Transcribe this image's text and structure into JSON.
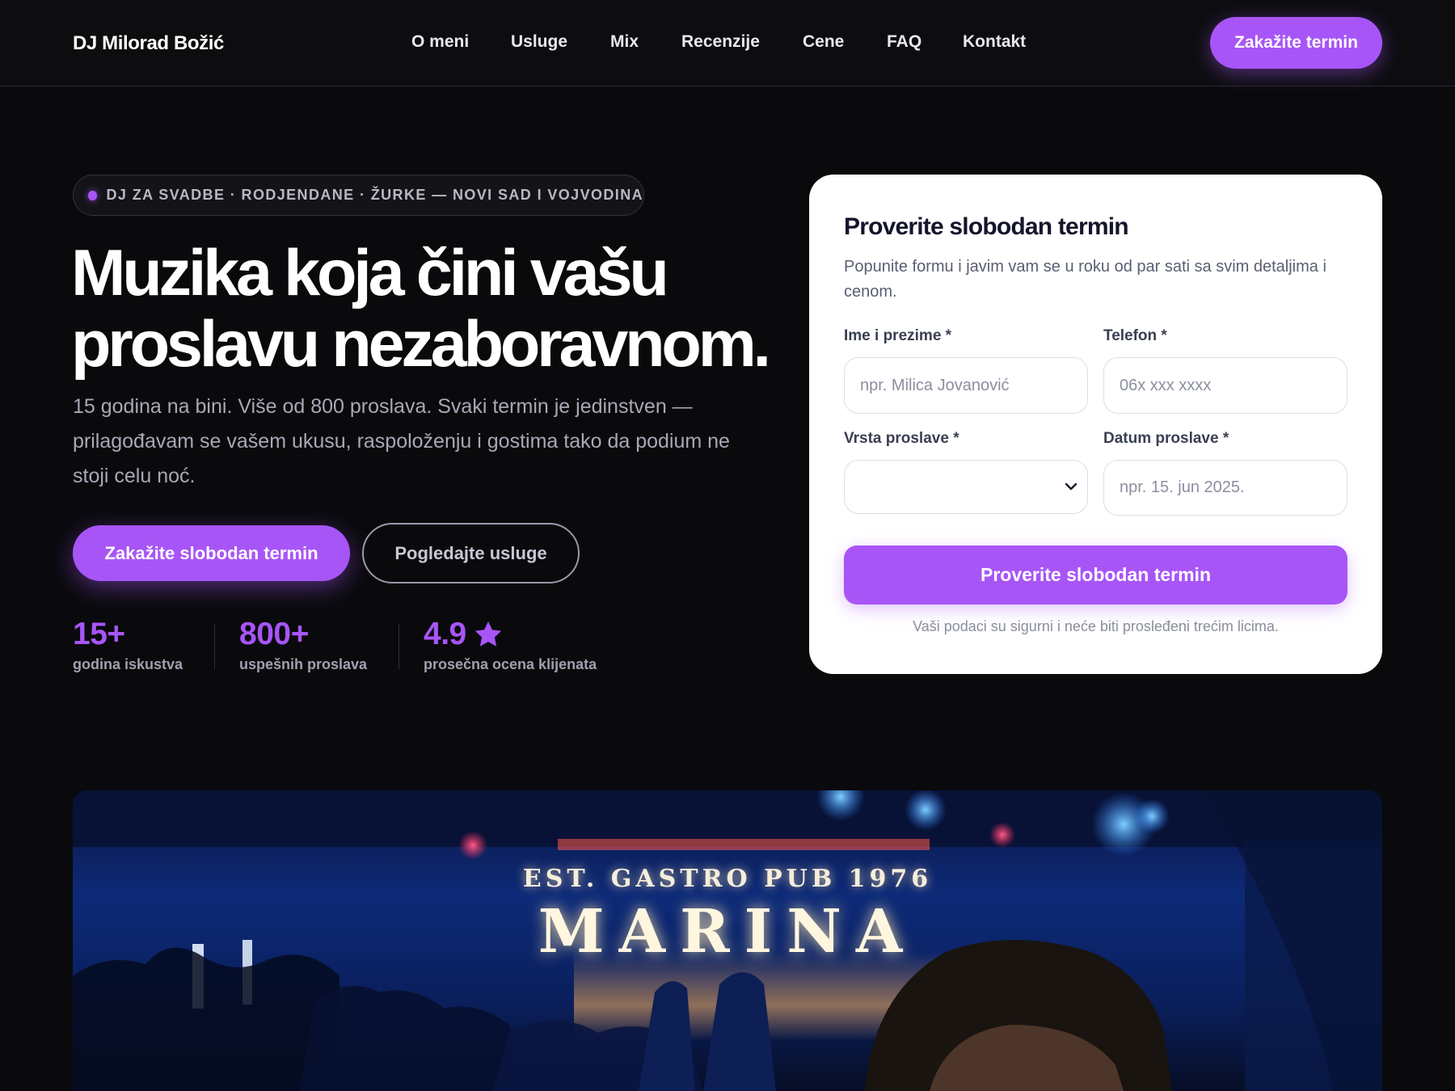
{
  "nav": {
    "brand": "DJ Milorad Božić",
    "links": [
      "O meni",
      "Usluge",
      "Mix",
      "Recenzije",
      "Cene",
      "FAQ",
      "Kontakt"
    ],
    "cta": "Zakažite termin"
  },
  "hero": {
    "pill": "DJ ZA SVADBE · RODJENDANE · ŽURKE — NOVI SAD I VOJVODINA",
    "title_line1": "Muzika koja čini vašu",
    "title_line2": "proslavu nezaboravnom.",
    "subtitle": "15 godina na bini. Više od 800 proslava. Svaki termin je jedinstven — prilagođavam se vašem ukusu, raspoloženju i gostima tako da podium ne stoji celu noć.",
    "primary_button": "Zakažite slobodan termin",
    "secondary_button": "Pogledajte usluge",
    "stats": [
      {
        "value": "15+",
        "label": "godina iskustva"
      },
      {
        "value": "800+",
        "label": "uspešnih proslava"
      },
      {
        "value": "4.9",
        "label": "prosečna ocena klijenata",
        "icon": "star-icon"
      }
    ]
  },
  "form": {
    "title": "Proverite slobodan termin",
    "subtitle": "Popunite formu i javim vam se u roku od par sati sa svim detaljima i cenom.",
    "name_label": "Ime i prezime *",
    "name_placeholder": "npr. Milica Jovanović",
    "phone_label": "Telefon *",
    "phone_placeholder": "06x xxx xxxx",
    "type_label": "Vrsta proslave *",
    "type_value": "",
    "date_label": "Datum proslave *",
    "date_placeholder": "npr. 15. jun 2025.",
    "submit": "Proverite slobodan termin",
    "privacy": "Vaši podaci su sigurni i neće biti prosleđeni trećim licima."
  },
  "photo": {
    "sign_line1": "EST. GASTRO PUB 1976",
    "sign_line2": "MARINA"
  },
  "colors": {
    "accent": "#a855f7",
    "background": "#0a0a0d",
    "card": "#ffffff"
  }
}
